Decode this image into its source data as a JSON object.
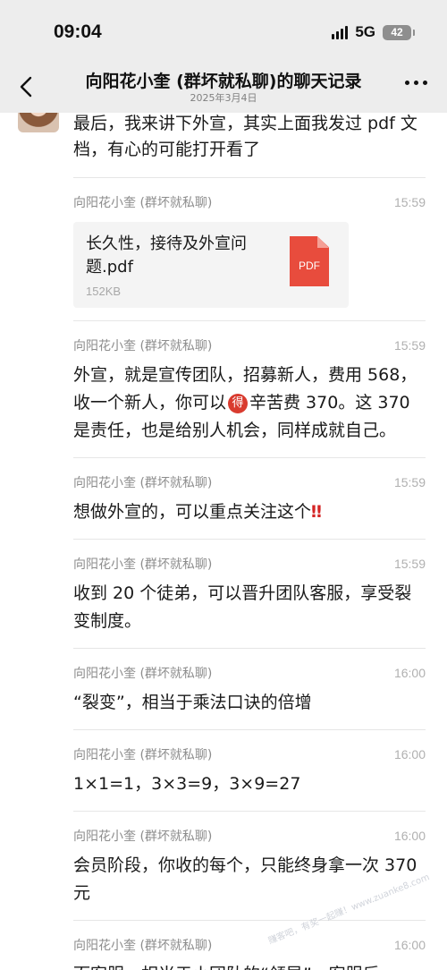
{
  "status_bar": {
    "time": "09:04",
    "network": "5G",
    "battery": "42"
  },
  "nav": {
    "back_icon": "chevron-left-icon",
    "title": "向阳花小奎 (群坏就私聊)的聊天记录",
    "date": "2025年3月4日",
    "more_icon": "more-dots-icon"
  },
  "first_message": {
    "text": "最后，我来讲下外宣，其实上面我发过 pdf 文档，有心的可能打开看了"
  },
  "messages": [
    {
      "sender": "向阳花小奎 (群坏就私聊)",
      "time": "15:59",
      "type": "file",
      "file_name": "长久性，接待及外宣问题.pdf",
      "file_size": "152KB",
      "file_icon_label": "PDF"
    },
    {
      "sender": "向阳花小奎 (群坏就私聊)",
      "time": "15:59",
      "type": "text",
      "text_before": "外宣，就是宣传团队，招募新人，费用 568，收一个新人，你可以",
      "emoji": "得",
      "text_after": "辛苦费 370。这 370 是责任，也是给别人机会，同样成就自己。"
    },
    {
      "sender": "向阳花小奎 (群坏就私聊)",
      "time": "15:59",
      "type": "text",
      "text": "想做外宣的，可以重点关注这个",
      "suffix": "‼"
    },
    {
      "sender": "向阳花小奎 (群坏就私聊)",
      "time": "15:59",
      "type": "text",
      "text": "收到 20 个徒弟，可以晋升团队客服，享受裂变制度。"
    },
    {
      "sender": "向阳花小奎 (群坏就私聊)",
      "time": "16:00",
      "type": "text",
      "text": "“裂变”，相当于乘法口诀的倍增"
    },
    {
      "sender": "向阳花小奎 (群坏就私聊)",
      "time": "16:00",
      "type": "text",
      "text": "1×1=1，3×3=9，3×9=27"
    },
    {
      "sender": "向阳花小奎 (群坏就私聊)",
      "time": "16:00",
      "type": "text",
      "text": "会员阶段，你收的每个，只能终身拿一次 370 元"
    },
    {
      "sender": "向阳花小奎 (群坏就私聊)",
      "time": "16:00",
      "type": "text",
      "text": "而客服，相当于小团队的“领导”，客服后"
    }
  ],
  "watermark": "赚客吧，有奖一起赚！www.zuanke8.com"
}
